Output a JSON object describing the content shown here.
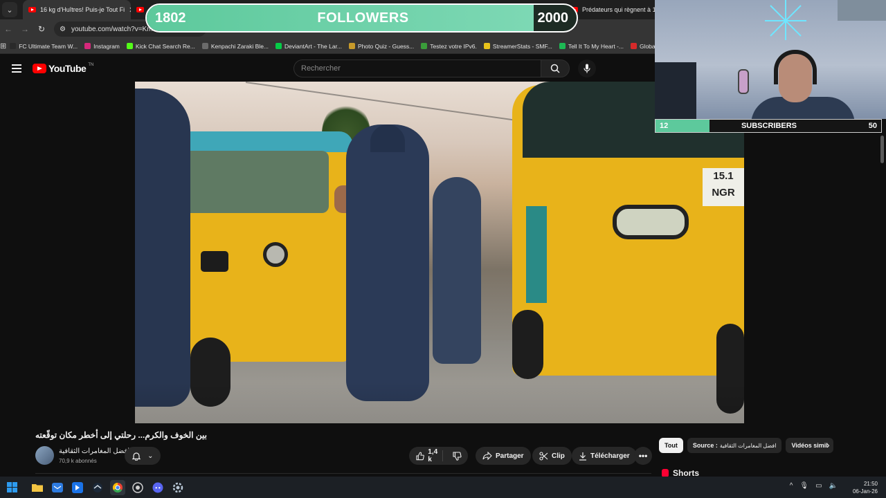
{
  "browser": {
    "active_tab_title": "16 kg d'Huîtres! Puis-je Tout Fi",
    "right_tab_title": "Prédateurs qui règnent à 107",
    "url": "youtube.com/watch?v=Km",
    "bookmarks": [
      {
        "label": "FC Ultimate Team W...",
        "color": "#2a2a2a"
      },
      {
        "label": "Instagram",
        "color": "#d6287b"
      },
      {
        "label": "Kick Chat Search Re...",
        "color": "#53fc18"
      },
      {
        "label": "Kenpachi Zaraki Ble...",
        "color": "#6b6b6b"
      },
      {
        "label": "DeviantArt - The Lar...",
        "color": "#05cc47"
      },
      {
        "label": "Photo Quiz - Guess...",
        "color": "#c79a2a"
      },
      {
        "label": "Testez votre IPv6.",
        "color": "#3a9d3a"
      },
      {
        "label": "StreamerStats - SMF...",
        "color": "#e8c21a"
      },
      {
        "label": "Tell It To My Heart -...",
        "color": "#1db954"
      },
      {
        "label": "GlobalN",
        "color": "#d62a2a"
      }
    ]
  },
  "youtube": {
    "logo_text": "YouTube",
    "logo_sup": "TN",
    "search_placeholder": "Rechercher"
  },
  "overlay": {
    "followers": {
      "current": "1802",
      "label": "FOLLOWERS",
      "goal": "2000",
      "progress": 0.9
    },
    "subscribers": {
      "current": "12",
      "label": "SUBSCRIBERS",
      "goal": "50",
      "progress": 0.24
    }
  },
  "video": {
    "plate_text": "15.1 NGR 15.1",
    "title": "بين الخوف والكرم... رحلتي إلى أخطر مكان توقّعته",
    "channel_name": "افضل المغامرات الثقافية",
    "channel_subs": "70,9 k abonnés",
    "like_count": "1,4 k",
    "share_label": "Partager",
    "clip_label": "Clip",
    "download_label": "Télécharger"
  },
  "chips": {
    "all": "Tout",
    "source_label": "Source :",
    "source_value": "افضل المغامرات الثقافية",
    "similar": "Vidéos simil"
  },
  "sidebar": {
    "shorts_label": "Shorts"
  },
  "taskbar": {
    "time": "21:50",
    "date": "06-Jan-26"
  }
}
